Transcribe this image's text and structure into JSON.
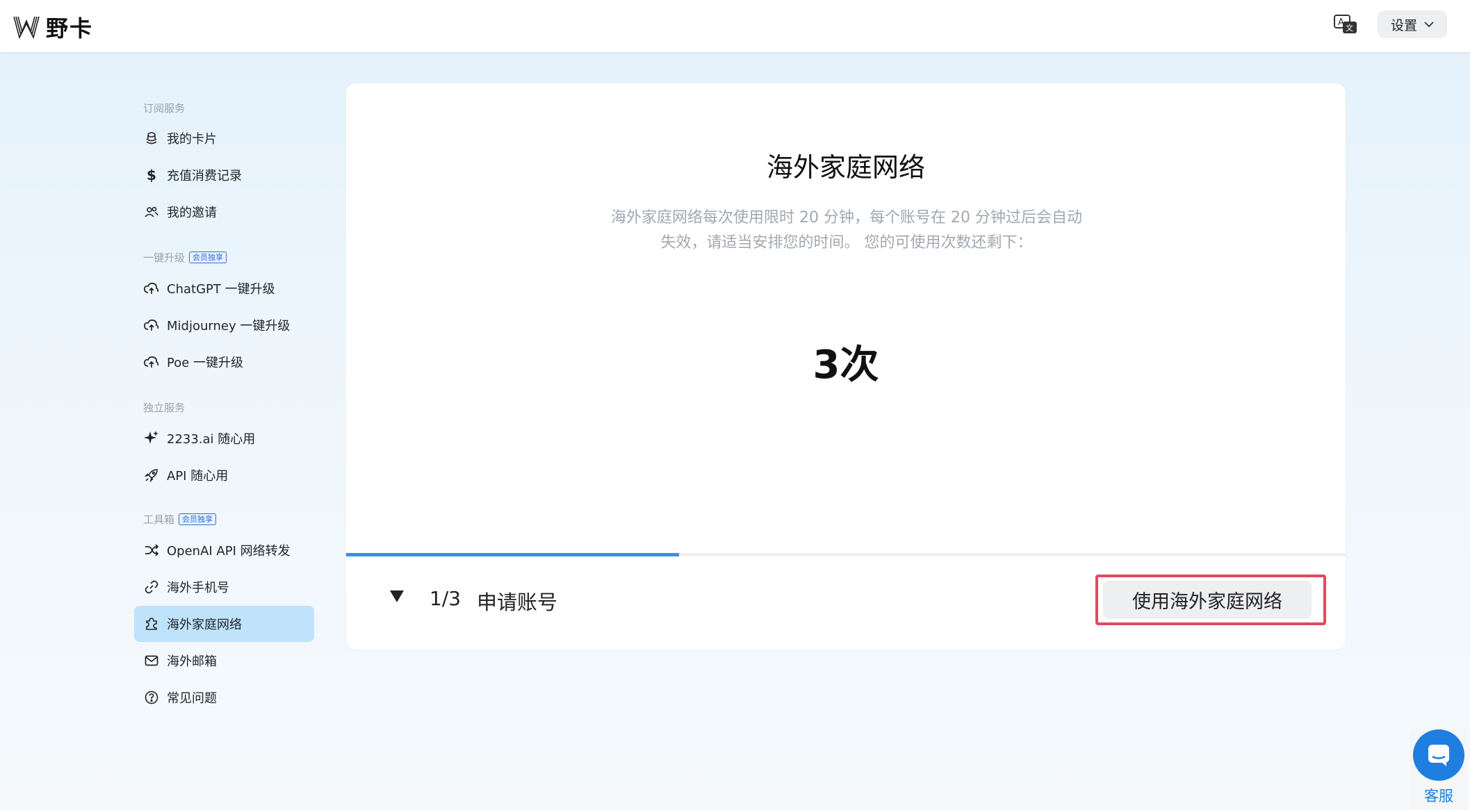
{
  "header": {
    "logo_text": "野卡",
    "translate_icon": "translate-icon",
    "settings_label": "设置"
  },
  "sidebar": {
    "sections": [
      {
        "title": "订阅服务",
        "badge": ""
      },
      {
        "title": "一键升级",
        "badge": "会员独享"
      },
      {
        "title": "独立服务",
        "badge": ""
      },
      {
        "title": "工具箱",
        "badge": "会员独享"
      }
    ],
    "items": [
      {
        "label": "我的卡片",
        "icon": "card-stack-icon"
      },
      {
        "label": "充值消费记录",
        "icon": "dollar-icon"
      },
      {
        "label": "我的邀请",
        "icon": "users-icon"
      },
      {
        "label": "ChatGPT 一键升级",
        "icon": "cloud-upload-icon"
      },
      {
        "label": "Midjourney 一键升级",
        "icon": "cloud-upload-icon"
      },
      {
        "label": "Poe 一键升级",
        "icon": "cloud-upload-icon"
      },
      {
        "label": "2233.ai 随心用",
        "icon": "sparkle-icon"
      },
      {
        "label": "API 随心用",
        "icon": "rocket-icon"
      },
      {
        "label": "OpenAI API 网络转发",
        "icon": "shuffle-icon"
      },
      {
        "label": "海外手机号",
        "icon": "link-icon"
      },
      {
        "label": "海外家庭网络",
        "icon": "puzzle-icon",
        "active": true
      },
      {
        "label": "海外邮箱",
        "icon": "mail-icon"
      },
      {
        "label": "常见问题",
        "icon": "help-circle-icon"
      }
    ]
  },
  "main": {
    "title": "海外家庭网络",
    "description": "海外家庭网络每次使用限时 20 分钟，每个账号在 20 分钟过后会自动失效，请适当安排您的时间。 您的可使用次数还剩下：",
    "count": "3次",
    "progress_fraction": 0.333,
    "step_number": "1/3",
    "step_label": "申请账号",
    "action_button": "使用海外家庭网络"
  },
  "support": {
    "label": "客服",
    "icon": "chat-icon"
  },
  "colors": {
    "accent": "#3f8be5",
    "active_bg": "#bfe3fa",
    "highlight": "#e8475f",
    "support": "#1e7fe0"
  }
}
